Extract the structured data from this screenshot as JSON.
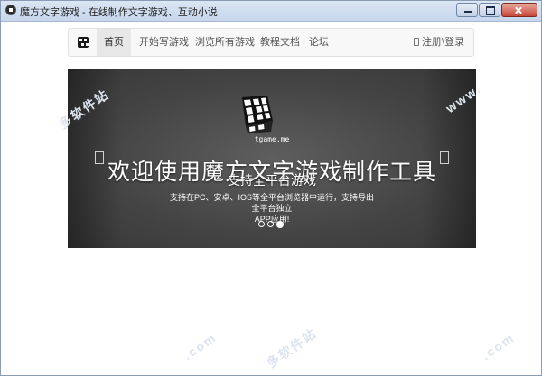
{
  "window": {
    "title": "魔方文字游戏 - 在线制作文字游戏、互动小说"
  },
  "navbar": {
    "items": [
      {
        "label": "首页",
        "active": true
      },
      {
        "label": "开始写游戏"
      },
      {
        "label": "浏览所有游戏"
      },
      {
        "label": "教程文档"
      },
      {
        "label": "论坛"
      }
    ],
    "auth": {
      "register": "注册",
      "separator": "\\",
      "login": "登录"
    }
  },
  "carousel": {
    "logo_caption": "tgame.me",
    "headline": "欢迎使用魔方文字游戏制作工具",
    "subheadline": "支持全平台游戏",
    "description_line1": "支持在PC、安卓、IOS等全平台浏览器中运行，支持导出全平台独立",
    "description_line2": "APP应用!",
    "slides_total": 3,
    "active_slide": 3
  },
  "watermarks": [
    "多软件站",
    "www.",
    ".com",
    "多软件站",
    ".com"
  ],
  "colors": {
    "carousel_bg": "#444444",
    "navbar_bg": "#f8f8f8",
    "nav_active_bg": "#e7e7e7"
  }
}
